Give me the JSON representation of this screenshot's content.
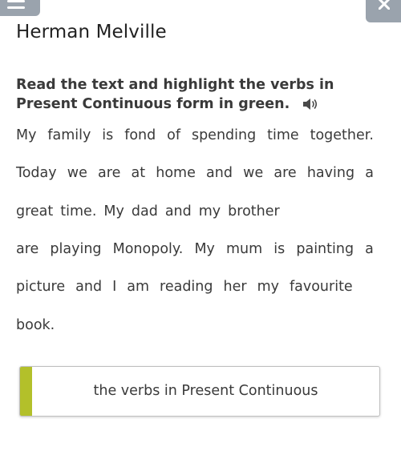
{
  "header": {
    "author": "Herman Melville",
    "menu_icon": "hamburger-menu-icon",
    "close_icon": "close-icon"
  },
  "task": {
    "instruction": "Read the text and highlight the verbs in Present Continuous form in green.",
    "audio_icon": "speaker-icon"
  },
  "text_lines": [
    [
      "My",
      "family",
      "is",
      "fond",
      "of",
      "spending",
      "time",
      "together."
    ],
    [
      "Today",
      "we",
      "are",
      "at",
      "home",
      "and",
      "we",
      "are",
      "having",
      "a"
    ],
    [
      "great",
      "time.",
      "My",
      "dad",
      "and",
      "my",
      "brother"
    ],
    [
      "are",
      "playing",
      "Monopoly.",
      "My",
      "mum",
      "is",
      "painting",
      "a"
    ],
    [
      "picture",
      "and",
      "I",
      "am",
      "reading",
      "her",
      "my",
      "favourite"
    ],
    [
      "book."
    ]
  ],
  "answer": {
    "label": "the verbs in Present Continuous",
    "accent_color": "#b3c02a"
  },
  "colors": {
    "button_gray": "#9aa3ad",
    "text": "#3a3a3a"
  }
}
